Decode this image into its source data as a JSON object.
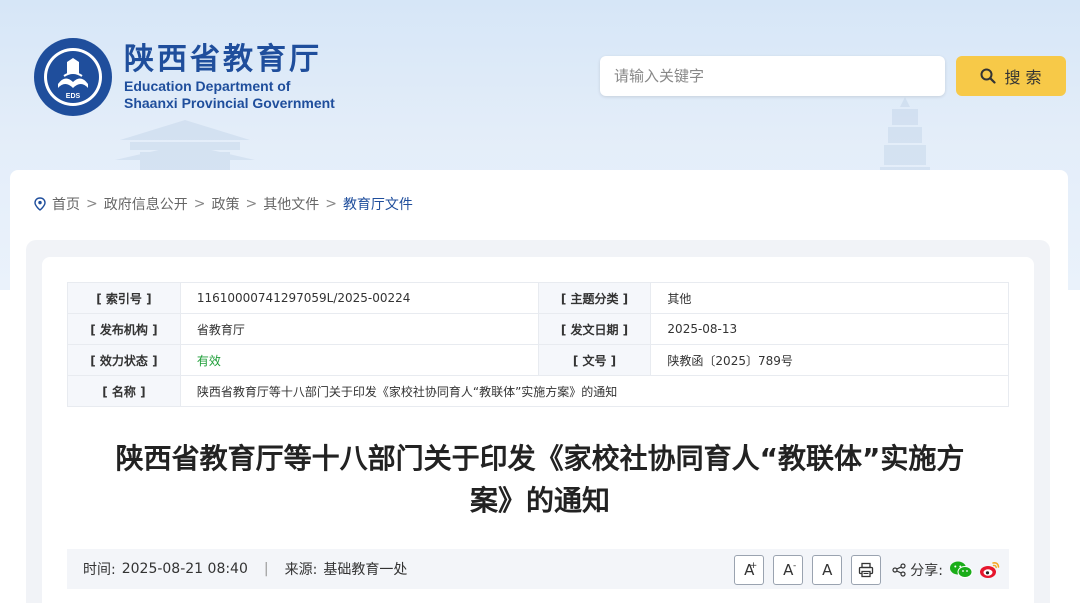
{
  "header": {
    "title_cn": "陕西省教育厅",
    "title_en_line1": "Education Department of",
    "title_en_line2": "Shaanxi Provincial Government",
    "seal_text": "EDS"
  },
  "search": {
    "placeholder": "请输入关键字",
    "button_label": "搜 索"
  },
  "breadcrumb": {
    "items": [
      "首页",
      "政府信息公开",
      "政策",
      "其他文件"
    ],
    "current": "教育厅文件",
    "separator": ">"
  },
  "meta": {
    "index_label": "[ 索引号 ]",
    "index_value": "11610000741297059L/2025-00224",
    "topic_label": "[ 主题分类 ]",
    "topic_value": "其他",
    "publisher_label": "[ 发布机构 ]",
    "publisher_value": "省教育厅",
    "date_label": "[ 发文日期 ]",
    "date_value": "2025-08-13",
    "status_label": "[ 效力状态 ]",
    "status_value": "有效",
    "docno_label": "[ 文号 ]",
    "docno_value": "陕教函〔2025〕789号",
    "name_label": "[ 名称 ]",
    "name_value": "陕西省教育厅等十八部门关于印发《家校社协同育人“教联体”实施方案》的通知"
  },
  "article": {
    "title_line1": "陕西省教育厅等十八部门关于印发《家校社协同育人“教联体”实施方",
    "title_line2": "案》的通知"
  },
  "infobar": {
    "time_label": "时间:",
    "time_value": "2025-08-21 08:40",
    "divider": "|",
    "source_label": "来源:",
    "source_value": "基础教育一处",
    "font_large": "A",
    "font_large_sup": "+",
    "font_small": "A",
    "font_small_sup": "-",
    "font_default": "A",
    "share_label": "分享:"
  },
  "colors": {
    "brand_blue": "#1f4e9c",
    "search_button": "#f7c948",
    "status_green": "#1e9e38"
  }
}
